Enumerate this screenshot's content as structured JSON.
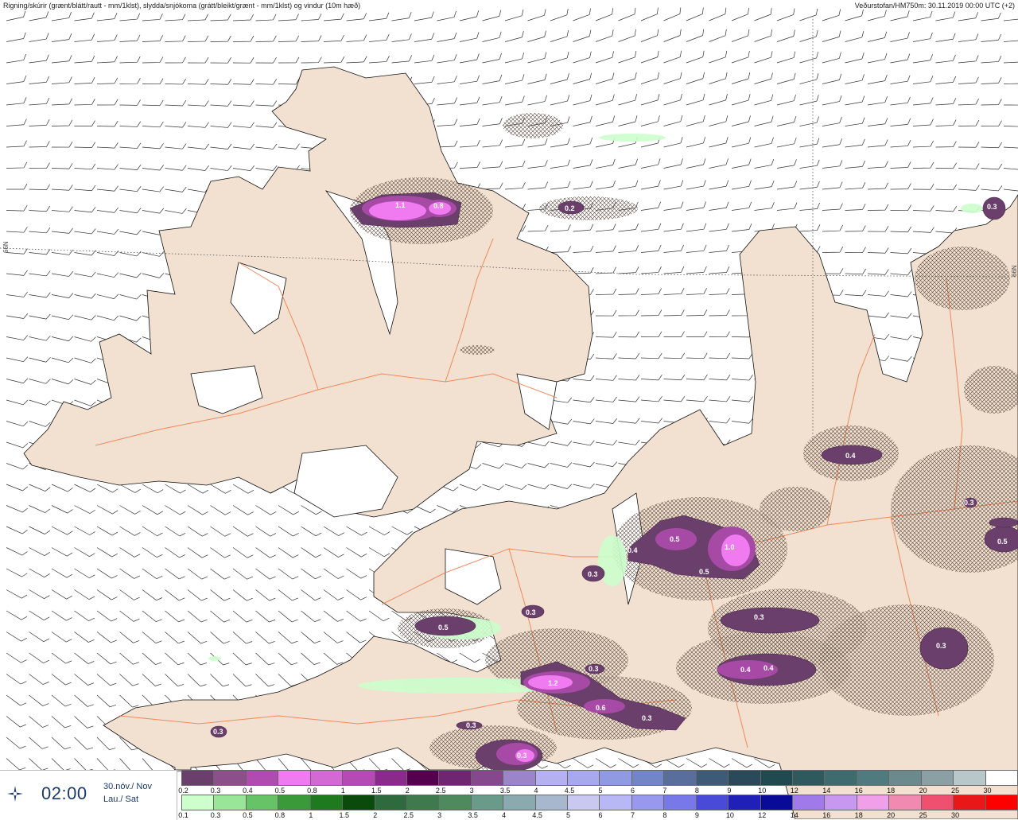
{
  "header": {
    "left": "Rigning/skúrir (grænt/blátt/rautt - mm/1klst), slydda/snjókoma (grátt/bleikt/grænt - mm/1klst) og vindur (10m hæð)",
    "right": "Veðurstofan/HM750m: 30.11.2019 00:00 UTC (+2)"
  },
  "latitude_label": "66N",
  "time_panel": {
    "logo_icon": "vedurstofan-logo-icon",
    "time": "02:00",
    "date_line1": "30.nóv./ Nov",
    "date_line2": "Lau./ Sat"
  },
  "legend_snow": {
    "labels": [
      "0.2",
      "0.3",
      "0.4",
      "0.5",
      "0.8",
      "1",
      "1.5",
      "2",
      "2.5",
      "3",
      "3.5",
      "4",
      "4.5",
      "5",
      "6",
      "7",
      "8",
      "9",
      "10",
      "12",
      "14",
      "16",
      "18",
      "20",
      "25",
      "30"
    ],
    "colors": [
      "#6b3f6b",
      "#8c4f8c",
      "#b04cb0",
      "#f07af0",
      "#d36ad3",
      "#b54ab5",
      "#8a2a8a",
      "#55004f",
      "#6e2673",
      "#86478e",
      "#9c84c8",
      "#b5b0f0",
      "#a8a8ee",
      "#8f9ae0",
      "#7285c6",
      "#5a6e9e",
      "#3d5a78",
      "#2a4a5a",
      "#1f4a50",
      "#2e5a5e",
      "#3d6b6e",
      "#4f7a7e",
      "#6b8a8e",
      "#8aa0a4",
      "#b8c8ca",
      "#ffffff"
    ]
  },
  "legend_rain": {
    "labels": [
      "0.1",
      "0.3",
      "0.5",
      "0.8",
      "1",
      "1.5",
      "2",
      "2.5",
      "3",
      "3.5",
      "4",
      "4.5",
      "5",
      "6",
      "7",
      "8",
      "9",
      "10",
      "12",
      "14",
      "16",
      "18",
      "20",
      "25",
      "30"
    ],
    "colors": [
      "#ccffcc",
      "#99e699",
      "#66c466",
      "#3a9a3a",
      "#1e7a1e",
      "#0a4a0a",
      "#2e6a3e",
      "#3e7a4e",
      "#4f8a5e",
      "#6a9a8a",
      "#8aaab0",
      "#a8b8cc",
      "#c8c8f0",
      "#b8b8f4",
      "#9898ee",
      "#7878e8",
      "#4a4ad8",
      "#2020b8",
      "#0a0a98",
      "#a07ae8",
      "#c898f0",
      "#f0a0e8",
      "#f08ab0",
      "#f05070",
      "#e81818",
      "#ff0000"
    ]
  },
  "map": {
    "labels": [
      {
        "text": "1.1"
      },
      {
        "text": "0.8"
      },
      {
        "text": "0.2"
      },
      {
        "text": "0.3"
      },
      {
        "text": "0.4"
      },
      {
        "text": "0.5"
      },
      {
        "text": "1.0"
      },
      {
        "text": "0.5"
      },
      {
        "text": "0.4"
      },
      {
        "text": "0.3"
      },
      {
        "text": "0.3"
      },
      {
        "text": "0.5"
      },
      {
        "text": "0.3"
      },
      {
        "text": "0.3"
      },
      {
        "text": "0.4"
      },
      {
        "text": "0.4"
      },
      {
        "text": "0.3"
      },
      {
        "text": "1.2"
      },
      {
        "text": "0.6"
      },
      {
        "text": "0.3"
      },
      {
        "text": "0.3"
      },
      {
        "text": "0.3"
      },
      {
        "text": "0.3"
      },
      {
        "text": "0.5"
      },
      {
        "text": "0.3"
      }
    ]
  }
}
